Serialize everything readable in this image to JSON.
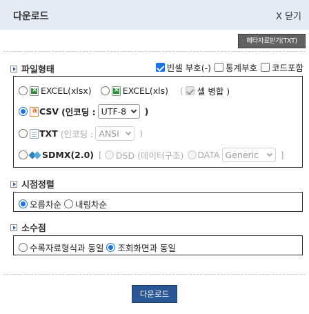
{
  "window": {
    "title": "다운로드",
    "close_label": "X 닫기"
  },
  "toolbar": {
    "meta_button": "메타자료받기(TXT)"
  },
  "file_format": {
    "label": "파일형태",
    "options": {
      "blank_cell": {
        "label": "빈셀 부호(-)",
        "checked": true
      },
      "stat_code": {
        "label": "통계부호",
        "checked": false
      },
      "code_include": {
        "label": "코드포함",
        "checked": false
      }
    },
    "excel_xlsx": {
      "label": "EXCEL(xlsx)",
      "selected": false,
      "icon": "excel-icon"
    },
    "excel_xls": {
      "label": "EXCEL(xls)",
      "selected": false,
      "icon": "excel-icon"
    },
    "merge": {
      "open": "(",
      "label": "셀 병합 )",
      "checked": true,
      "disabled": true
    },
    "csv": {
      "label": "CSV",
      "encoding_label": "(인코딩 :",
      "encoding_value": "UTF-8",
      "close": ")",
      "selected": true,
      "icon": "csv-icon"
    },
    "txt": {
      "label": "TXT",
      "encoding_label": "(인코딩 :",
      "encoding_value": "ANSI",
      "close": ")",
      "selected": false,
      "icon": "txt-icon"
    },
    "sdmx": {
      "label": "SDMX(2.0)",
      "open_bracket": "[",
      "dsd_label": "DSD (데이터구조)",
      "data_label": "DATA",
      "data_value": "Generic",
      "close_bracket": "]",
      "selected": false,
      "icon": "sdmx-icon"
    }
  },
  "time_sort": {
    "label": "시점정렬",
    "ascending": {
      "label": "오름차순",
      "selected": true
    },
    "descending": {
      "label": "내림차순",
      "selected": false
    }
  },
  "decimal": {
    "label": "소수점",
    "same_as_data": {
      "label": "수록자료형식과 동일",
      "selected": false
    },
    "same_as_view": {
      "label": "조회화면과 동일",
      "selected": true
    }
  },
  "footer": {
    "download_button": "다운로드"
  },
  "colors": {
    "titlebar_bg": "#e3ebf7",
    "accent": "#1a73e8",
    "primary_button": "#2b5797",
    "meta_button": "#616161"
  }
}
